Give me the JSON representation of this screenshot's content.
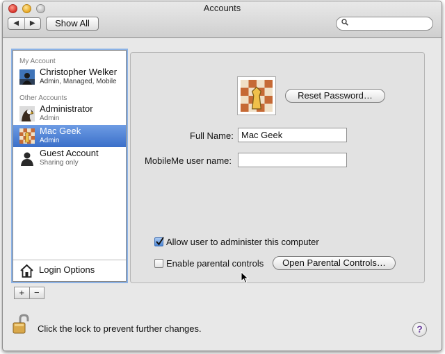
{
  "window": {
    "title": "Accounts"
  },
  "toolbar": {
    "back_glyph": "◀",
    "forward_glyph": "▶",
    "show_all_label": "Show All",
    "search_placeholder": ""
  },
  "sidebar": {
    "my_account_header": "My Account",
    "other_accounts_header": "Other Accounts",
    "my_account": {
      "name": "Christopher Welker",
      "subtitle": "Admin, Managed, Mobile",
      "icon": "person-photo-icon"
    },
    "accounts": [
      {
        "name": "Administrator",
        "subtitle": "Admin",
        "icon": "eagle-icon",
        "selected": false
      },
      {
        "name": "Mac Geek",
        "subtitle": "Admin",
        "icon": "chess-icon",
        "selected": true
      },
      {
        "name": "Guest Account",
        "subtitle": "Sharing only",
        "icon": "silhouette-icon",
        "selected": false
      }
    ],
    "login_options_label": "Login Options",
    "add_label": "+",
    "remove_label": "−"
  },
  "detail": {
    "reset_password_label": "Reset Password…",
    "full_name_label": "Full Name:",
    "full_name_value": "Mac Geek",
    "mobileme_label": "MobileMe user name:",
    "mobileme_value": "",
    "allow_admin_label": "Allow user to administer this computer",
    "allow_admin_checked": true,
    "parental_label": "Enable parental controls",
    "parental_checked": false,
    "open_parental_label": "Open Parental Controls…"
  },
  "footer": {
    "lock_text": "Click the lock to prevent further changes.",
    "help_glyph": "?"
  },
  "colors": {
    "selection": "#3a6fc9",
    "focus_ring": "#8bb2e6"
  }
}
